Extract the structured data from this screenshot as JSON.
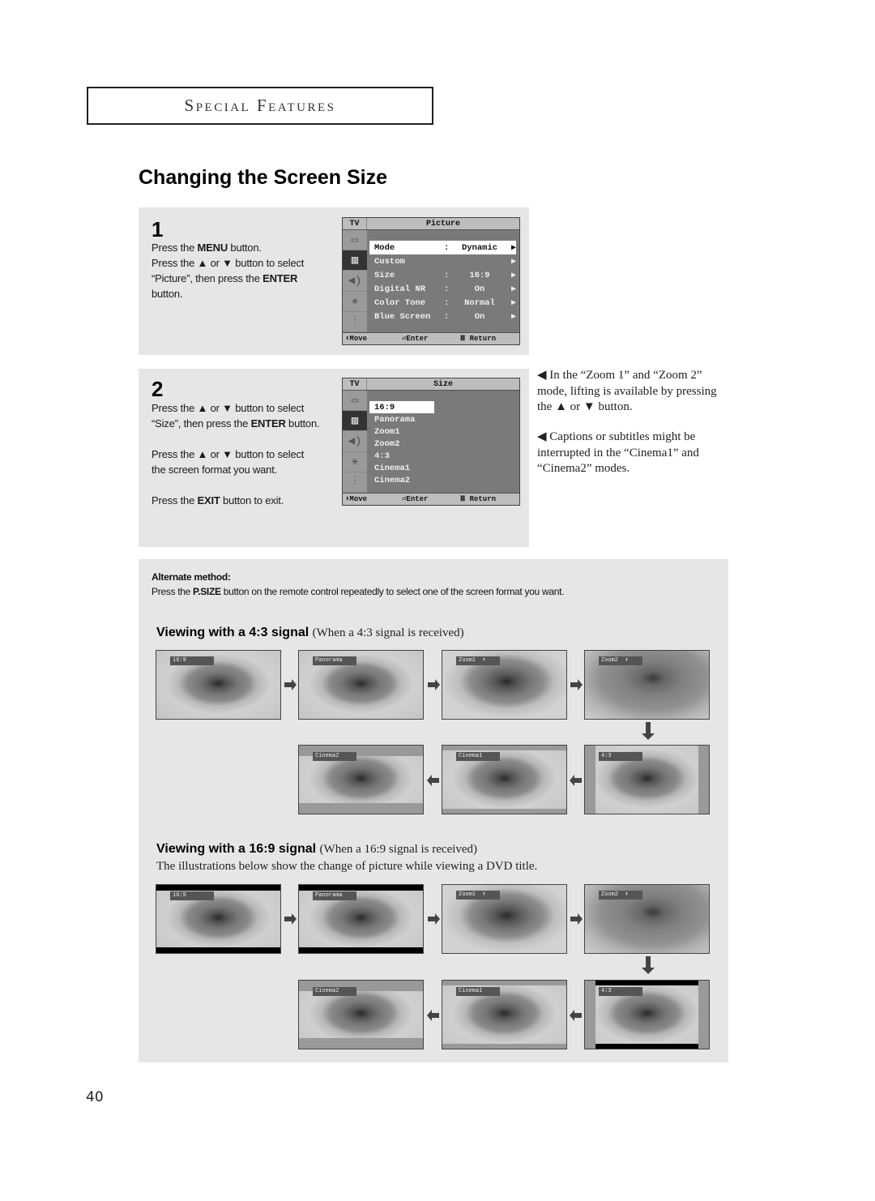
{
  "section_header": "Special Features",
  "page_title": "Changing the Screen Size",
  "step1": {
    "number": "1",
    "lines": [
      {
        "pre": "Press the ",
        "bold": "MENU",
        "post": " button."
      },
      {
        "pre": "Press the ▲ or ▼ button to select",
        "bold": "",
        "post": ""
      },
      {
        "pre": "“Picture”, then press the ",
        "bold": "ENTER",
        "post": ""
      },
      {
        "pre": "button.",
        "bold": "",
        "post": ""
      }
    ],
    "osd": {
      "tv_label": "TV",
      "title": "Picture",
      "rows": [
        {
          "label": "Mode",
          "sep": ":",
          "value": "Dynamic",
          "arrow": "▶",
          "selected": true
        },
        {
          "label": "Custom",
          "sep": "",
          "value": "",
          "arrow": "▶",
          "selected": false
        },
        {
          "label": "Size",
          "sep": ":",
          "value": "16:9",
          "arrow": "▶",
          "selected": false
        },
        {
          "label": "Digital NR",
          "sep": ":",
          "value": "On",
          "arrow": "▶",
          "selected": false
        },
        {
          "label": "Color Tone",
          "sep": ":",
          "value": "Normal",
          "arrow": "▶",
          "selected": false
        },
        {
          "label": "Blue Screen",
          "sep": ":",
          "value": "On",
          "arrow": "▶",
          "selected": false
        }
      ],
      "footer": {
        "move": "⬍Move",
        "enter": "⏎Enter",
        "return": "Ⅲ Return"
      }
    }
  },
  "step2": {
    "number": "2",
    "paragraphs": [
      {
        "l1": "Press the ▲ or ▼ button to select",
        "l2pre": "“Size”, then press the ",
        "l2bold": "ENTER",
        "l2post": " button."
      },
      {
        "l1": "Press the ▲ or ▼ button to select",
        "l2pre": "the screen format you want.",
        "l2bold": "",
        "l2post": ""
      },
      {
        "l1pre": "Press the ",
        "l1bold": "EXIT",
        "l1post": " button to exit."
      }
    ],
    "osd": {
      "tv_label": "TV",
      "title": "Size",
      "options": [
        "16:9",
        "Panorama",
        "Zoom1",
        "Zoom2",
        "4:3",
        "Cinema1",
        "Cinema2"
      ],
      "selected_index": 0,
      "footer": {
        "move": "⬍Move",
        "enter": "⏎Enter",
        "return": "Ⅲ Return"
      }
    }
  },
  "notes": [
    "◀ In the “Zoom 1” and “Zoom 2” mode, lifting is available by pressing the ▲ or ▼ button.",
    "◀ Captions or subtitles might be interrupted in the “Cinema1” and “Cinema2” modes."
  ],
  "alternate": {
    "title": "Alternate method:",
    "pre": "Press the ",
    "bold": "P.SIZE",
    "post": " button on the remote control repeatedly to select one of the screen format you want."
  },
  "view43": {
    "heading": "Viewing with a 4:3 signal",
    "sub": "(When a 4:3 signal is received)",
    "row1": [
      "16:9",
      "Panorama",
      "Zoom1  ⬍",
      "Zoom2  ⬍"
    ],
    "row2": [
      "Cinema2",
      "Cinema1",
      "4:3"
    ]
  },
  "view169": {
    "heading": "Viewing with a 16:9 signal",
    "sub": "(When a 16:9 signal is received)",
    "description": "The illustrations below show the change of picture while viewing a DVD title.",
    "row1": [
      "16:9",
      "Panorama",
      "Zoom1  ⬍",
      "Zoom2  ⬍"
    ],
    "row2": [
      "Cinema2",
      "Cinema1",
      "4:3"
    ]
  },
  "page_number": "40"
}
